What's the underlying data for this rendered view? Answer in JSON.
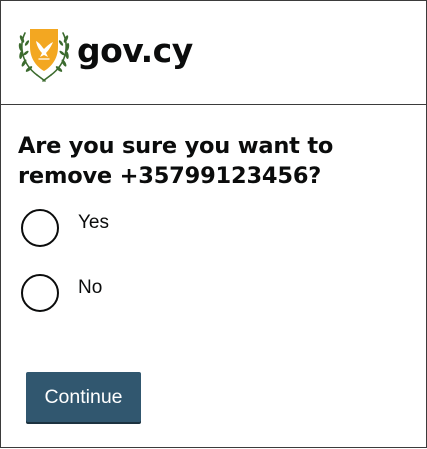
{
  "header": {
    "logo_icon": "cyprus-emblem-icon",
    "logo_text": "gov.cy"
  },
  "question": {
    "heading": "Are you sure you want to remove +35799123456?"
  },
  "options": [
    {
      "label": "Yes",
      "selected": false
    },
    {
      "label": "No",
      "selected": false
    }
  ],
  "actions": {
    "continue_label": "Continue"
  },
  "colors": {
    "button_bg": "#31576f",
    "button_text": "#ffffff",
    "text": "#0b0c0c",
    "emblem_gold": "#f3a721",
    "emblem_green": "#3c6b2f",
    "border": "#3b3b3b"
  }
}
